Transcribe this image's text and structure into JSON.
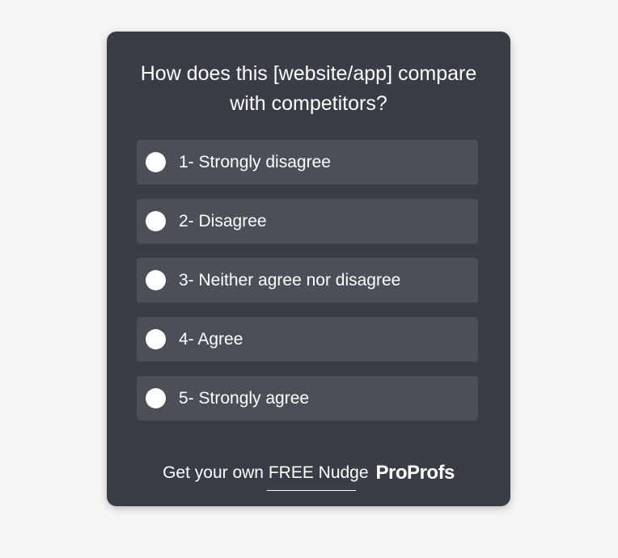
{
  "survey": {
    "question": "How does this [website/app] compare with competitors?",
    "options": [
      {
        "label": "1- Strongly disagree"
      },
      {
        "label": "2- Disagree"
      },
      {
        "label": "3- Neither agree nor disagree"
      },
      {
        "label": "4- Agree"
      },
      {
        "label": "5- Strongly agree"
      }
    ],
    "footer_text": "Get your own FREE Nudge",
    "brand": "ProProfs"
  },
  "colors": {
    "page_background": "#f5f5f5",
    "card_background": "#393d46",
    "option_background": "#4b4f57",
    "text": "#ffffff"
  }
}
